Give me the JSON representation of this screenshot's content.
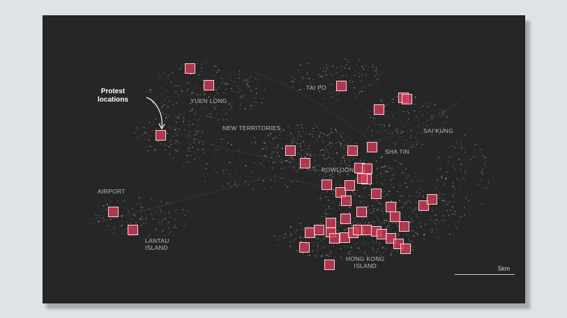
{
  "map": {
    "annotation": [
      "Protest",
      "locations"
    ],
    "places": {
      "yuen_long": "YUEN LONG",
      "tai_po": "TAI PO",
      "new_territories": "NEW TERRITORIES",
      "sai_kung": "SAI KUNG",
      "sha_tin": "SHA TIN",
      "kowloon": "KOWLOON",
      "airport": "AIRPORT",
      "lantau": [
        "LANTAU",
        "ISLAND"
      ],
      "hong_kong_island": [
        "HONG KONG",
        "ISLAND"
      ]
    },
    "scale": "5km",
    "marker_color": "#d63c58",
    "marker_border": "#ffdce1",
    "background_color": "#262626"
  }
}
